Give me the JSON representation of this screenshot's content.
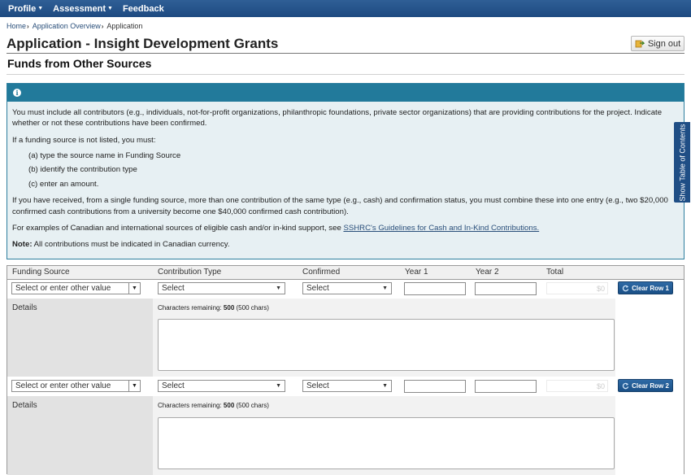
{
  "nav": {
    "items": [
      {
        "label": "Profile"
      },
      {
        "label": "Assessment"
      },
      {
        "label": "Feedback"
      }
    ]
  },
  "breadcrumb": {
    "home": "Home",
    "overview": "Application Overview",
    "current": "Application"
  },
  "page": {
    "title": "Application - Insight Development Grants",
    "signout_label": "Sign out",
    "section_title": "Funds from Other Sources"
  },
  "side_tab": {
    "label": "Show Table of Contents"
  },
  "info": {
    "p1": "You must include all contributors (e.g., individuals, not-for-profit organizations, philanthropic foundations, private sector organizations) that are providing contributions for the project. Indicate whether or not these contributions have been confirmed.",
    "p2": "If a funding source is not listed, you must:",
    "items": [
      "(a) type the source name in Funding Source",
      "(b) identify the contribution type",
      "(c) enter an amount."
    ],
    "p3": "If you have received, from a single funding source, more than one contribution of the same type (e.g., cash) and confirmation status, you must combine these into one entry (e.g., two $20,000 confirmed cash contributions from a university become one $40,000 confirmed cash contribution).",
    "p4_prefix": "For examples of Canadian and international sources of eligible cash and/or in-kind support, see ",
    "p4_link": "SSHRC's Guidelines for Cash and In-Kind Contributions.",
    "note_label": "Note:",
    "note_text": " All contributions must be indicated in Canadian currency."
  },
  "table": {
    "headers": {
      "funding_source": "Funding Source",
      "contribution_type": "Contribution Type",
      "confirmed": "Confirmed",
      "year1": "Year 1",
      "year2": "Year 2",
      "total": "Total"
    },
    "rows": [
      {
        "funding_source_placeholder": "Select or enter other value",
        "contribution_type": "Select",
        "confirmed": "Select",
        "total": "$0",
        "clear_label": "Clear Row 1",
        "details_label": "Details",
        "chars_prefix": "Characters remaining: ",
        "chars_count": "500",
        "chars_suffix": " (500 chars)"
      },
      {
        "funding_source_placeholder": "Select or enter other value",
        "contribution_type": "Select",
        "confirmed": "Select",
        "total": "$0",
        "clear_label": "Clear Row 2",
        "details_label": "Details",
        "chars_prefix": "Characters remaining: ",
        "chars_count": "500",
        "chars_suffix": " (500 chars)"
      }
    ]
  }
}
